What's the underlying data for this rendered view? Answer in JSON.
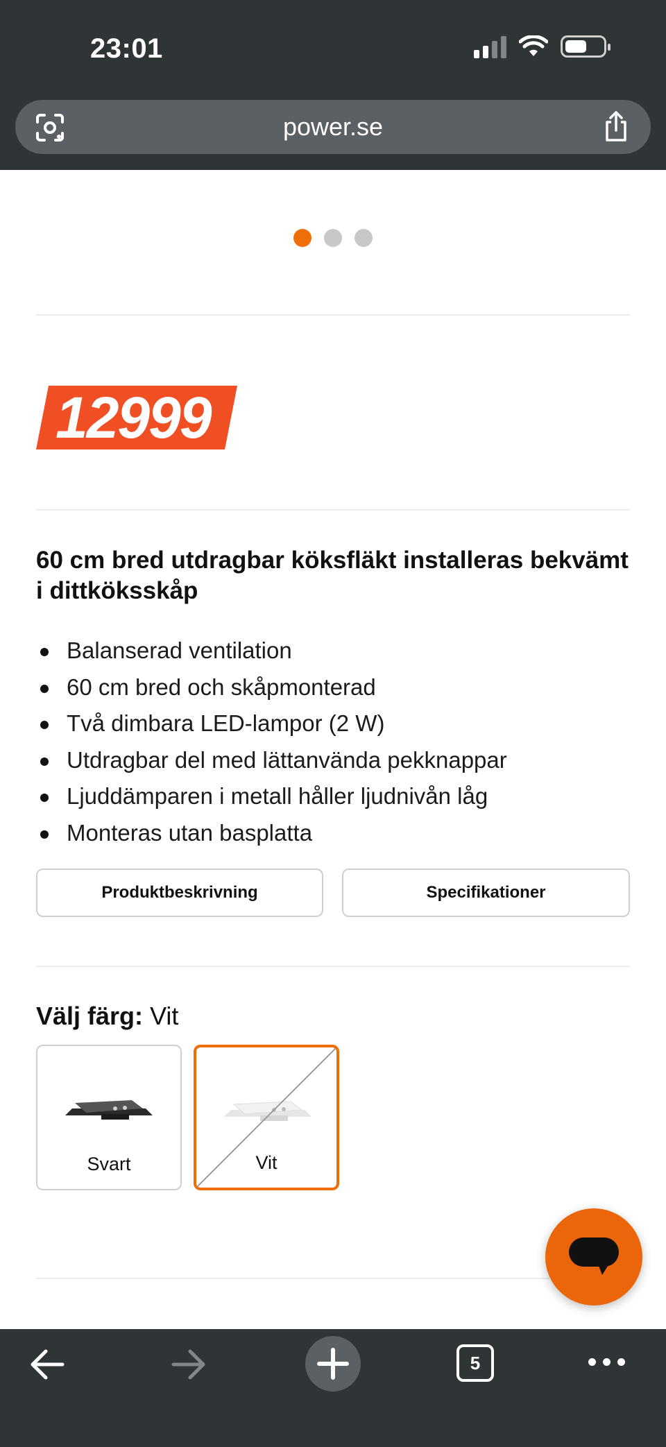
{
  "status_bar": {
    "time": "23:01"
  },
  "browser": {
    "url": "power.se",
    "tab_count": "5"
  },
  "carousel": {
    "dot_count": 3,
    "active_index": 0,
    "accent_color": "#f06e0a"
  },
  "product": {
    "price": "12999",
    "price_color": "#f04e23",
    "title": "60 cm bred utdragbar köksfläkt installeras bekvämt i dittköksskåp",
    "features": [
      "Balanserad ventilation",
      "60 cm bred och skåpmonterad",
      "Två dimbara LED-lampor (2 W)",
      "Utdragbar del med lättanvända pekknappar",
      "Ljuddämparen i metall håller ljudnivån låg",
      "Monteras utan basplatta"
    ]
  },
  "buttons": {
    "description": "Produktbeskrivning",
    "specifications": "Specifikationer"
  },
  "color_picker": {
    "label": "Välj färg:",
    "selected": "Vit",
    "options": [
      {
        "name": "Svart",
        "selected": false,
        "unavailable": false
      },
      {
        "name": "Vit",
        "selected": true,
        "unavailable": true
      }
    ]
  },
  "icons": {
    "address_left": "lens-icon",
    "address_right": "share-icon",
    "chat": "chat-icon",
    "toolbar": [
      "back-arrow-icon",
      "forward-arrow-icon",
      "plus-icon",
      "tabs-icon",
      "more-icon"
    ]
  }
}
